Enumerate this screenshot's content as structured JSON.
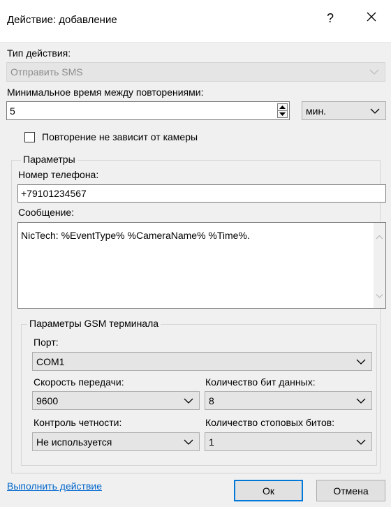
{
  "window": {
    "title": "Действие: добавление",
    "help": "?",
    "close_icon": "close-icon"
  },
  "action_type": {
    "label": "Тип действия:",
    "value": "Отправить SMS"
  },
  "min_interval": {
    "label": "Минимальное время между повторениями:",
    "value": "5",
    "unit": "мин."
  },
  "repeat_checkbox": {
    "label": "Повторение не зависит от камеры",
    "checked": false
  },
  "params": {
    "legend": "Параметры",
    "phone_label": "Номер телефона:",
    "phone_value": "+79101234567",
    "message_label": "Сообщение:",
    "message_value": "NicTech: %EventType% %CameraName% %Time%."
  },
  "gsm": {
    "legend": "Параметры GSM терминала",
    "port_label": "Порт:",
    "port_value": "COM1",
    "speed_label": "Скорость передачи:",
    "speed_value": "9600",
    "databits_label": "Количество бит данных:",
    "databits_value": "8",
    "parity_label": "Контроль четности:",
    "parity_value": "Не используется",
    "stopbits_label": "Количество стоповых битов:",
    "stopbits_value": "1"
  },
  "footer": {
    "run_link": "Выполнить действие",
    "ok": "Ок",
    "cancel": "Отмена"
  }
}
